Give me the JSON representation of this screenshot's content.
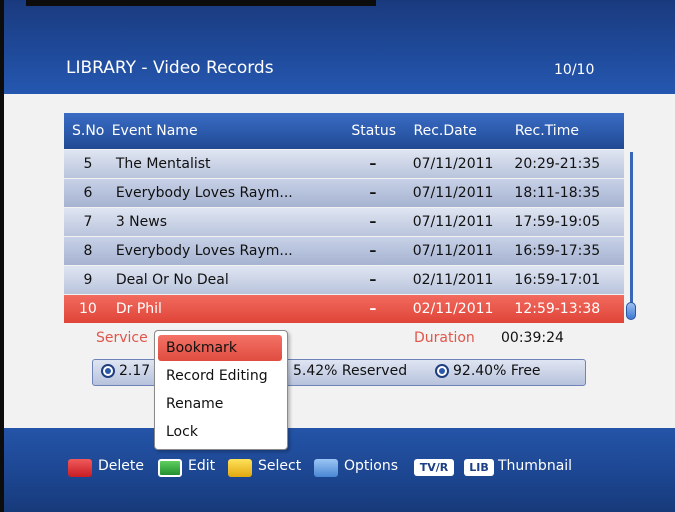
{
  "header": {
    "title": "LIBRARY - Video Records",
    "page_count": "10/10"
  },
  "table": {
    "columns": [
      "S.No",
      "Event Name",
      "Status",
      "Rec.Date",
      "Rec.Time"
    ],
    "rows": [
      {
        "no": "5",
        "name": "The Mentalist",
        "status": "–",
        "date": "07/11/2011",
        "time": "20:29-21:35"
      },
      {
        "no": "6",
        "name": "Everybody Loves Raym...",
        "status": "–",
        "date": "07/11/2011",
        "time": "18:11-18:35"
      },
      {
        "no": "7",
        "name": "3 News",
        "status": "–",
        "date": "07/11/2011",
        "time": "17:59-19:05"
      },
      {
        "no": "8",
        "name": "Everybody Loves Raym...",
        "status": "–",
        "date": "07/11/2011",
        "time": "16:59-17:35"
      },
      {
        "no": "9",
        "name": "Deal Or No Deal",
        "status": "–",
        "date": "02/11/2011",
        "time": "16:59-17:01"
      },
      {
        "no": "10",
        "name": "Dr Phil",
        "status": "–",
        "date": "02/11/2011",
        "time": "12:59-13:38"
      }
    ],
    "selected_index": 5
  },
  "details": {
    "service_label": "Service",
    "duration_label": "Duration",
    "duration_value": "00:39:24"
  },
  "disk": {
    "used": "2.17",
    "reserved": "5.42% Reserved",
    "free": "92.40% Free"
  },
  "popup_menu": {
    "items": [
      "Bookmark",
      "Record Editing",
      "Rename",
      "Lock"
    ],
    "active_index": 0
  },
  "footer": {
    "delete_label": "Delete",
    "edit_label": "Edit",
    "select_label": "Select",
    "options_label": "Options",
    "tvr_key": "TV/R",
    "lib_key": "LIB",
    "thumbnail_label": "Thumbnail",
    "colors": {
      "red": "#d8262d",
      "green": "#2ea33a",
      "yellow": "#f0c419",
      "blue": "#5b9ae0"
    }
  },
  "colors": {
    "accent_blue": "#1f4a9a",
    "selection_red": "#e04438",
    "label_red": "#e0564a"
  }
}
